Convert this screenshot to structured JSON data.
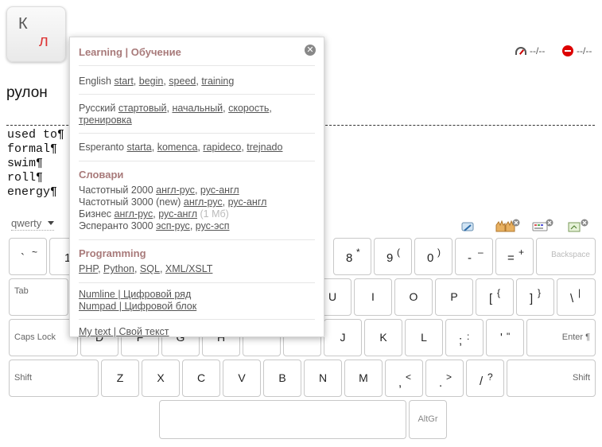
{
  "logo": {
    "k": "К",
    "l": "л"
  },
  "status": {
    "speed": "--/--",
    "errors": "--/--"
  },
  "word": "рулон",
  "lines": [
    "used to¶",
    "formal¶",
    "swim¶",
    "roll¶",
    "energy¶"
  ],
  "layout": "qwerty",
  "keys": {
    "tilde_low": "`",
    "tilde_up": "~",
    "one": "1",
    "eight": "8",
    "eight_up": "*",
    "nine": "9",
    "nine_up": "(",
    "zero": "0",
    "zero_up": ")",
    "minus": "-",
    "minus_up": "–",
    "equals": "=",
    "equals_up": "+",
    "backspace": "Backspace",
    "tab": "Tab",
    "u": "U",
    "i": "I",
    "o": "O",
    "p": "P",
    "lb": "[",
    "lb_up": "{",
    "rb": "]",
    "rb_up": "}",
    "bs": "\\",
    "bs_up": "|",
    "caps": "Caps Lock",
    "d": "D",
    "f": "F",
    "g": "G",
    "h": "H",
    "j": "J",
    "k": "K",
    "l": "L",
    "semi": ";",
    "semi_up": ":",
    "quote": "'",
    "quote_up": "\"",
    "enter": "Enter ¶",
    "shift": "Shift",
    "z": "Z",
    "x": "X",
    "c": "C",
    "v": "V",
    "b": "B",
    "n": "N",
    "m": "M",
    "comma": ",",
    "comma_up": "<",
    "period": ".",
    "period_up": ">",
    "slash": "/",
    "slash_up": "?",
    "shift_r": "Shift",
    "altgr": "AltGr"
  },
  "menu": {
    "learning_title": "Learning | Обучение",
    "english_label": "English",
    "english_links": [
      "start",
      "begin",
      "speed",
      "training"
    ],
    "russian_label": "Русский",
    "russian_links": [
      "стартовый",
      "начальный",
      "скорость",
      "тренировка"
    ],
    "esperanto_label": "Esperanto",
    "esperanto_links": [
      "starta",
      "komenca",
      "rapideco",
      "trejnado"
    ],
    "dict_title": "Словари",
    "dict1_label": "Частотный 2000",
    "dict1_links": [
      "англ-рус",
      "рус-англ"
    ],
    "dict2_label": "Частотный 3000 (new)",
    "dict2_links": [
      "англ-рус",
      "рус-англ"
    ],
    "dict3_label": "Бизнес",
    "dict3_links": [
      "англ-рус",
      "рус-англ"
    ],
    "dict3_note": "(1 Мб)",
    "dict4_label": "Эсперанто 3000",
    "dict4_links": [
      "эсп-рус",
      "рус-эсп"
    ],
    "prog_title": "Programming",
    "prog_links": [
      "PHP",
      "Python",
      "SQL",
      "XML/XSLT"
    ],
    "numline": "Numline | Цифровой ряд",
    "numpad": "Numpad | Цифровой блок",
    "mytext": "My text | Свой текст"
  }
}
